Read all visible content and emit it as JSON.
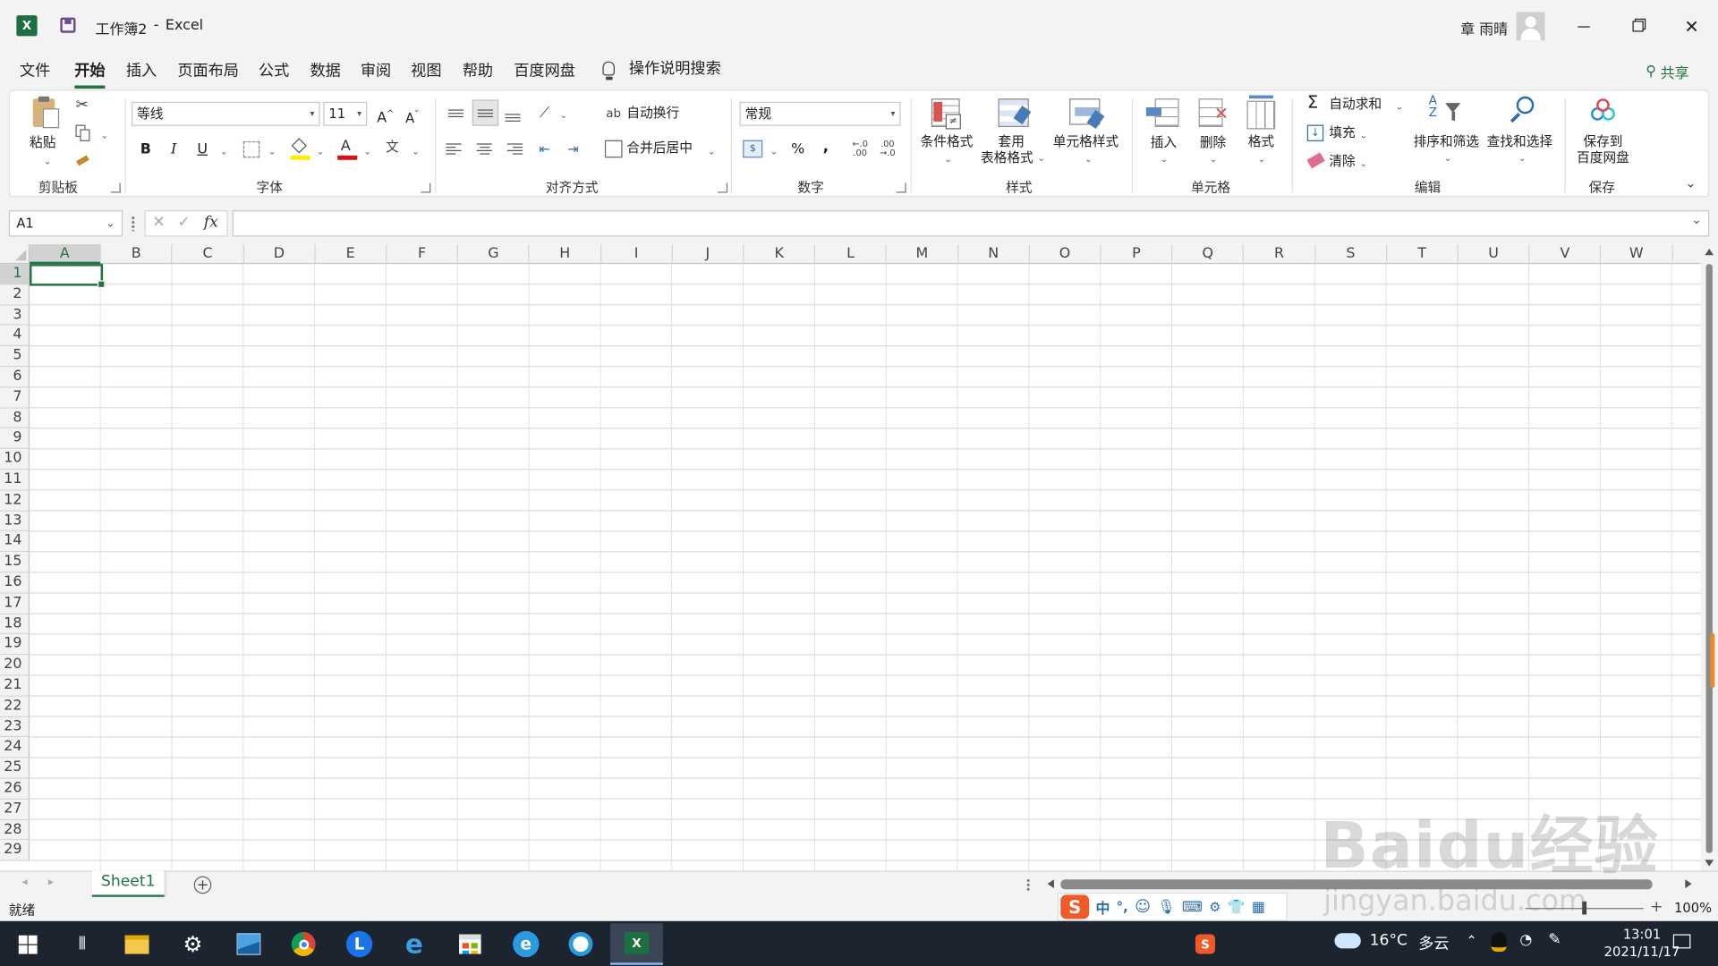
{
  "titlebar": {
    "doc_title": "工作簿2",
    "separator": "-",
    "app_name": "Excel",
    "user_name": "章 雨晴"
  },
  "menu": {
    "tabs": [
      {
        "label": "文件"
      },
      {
        "label": "开始"
      },
      {
        "label": "插入"
      },
      {
        "label": "页面布局"
      },
      {
        "label": "公式"
      },
      {
        "label": "数据"
      },
      {
        "label": "审阅"
      },
      {
        "label": "视图"
      },
      {
        "label": "帮助"
      },
      {
        "label": "百度网盘"
      }
    ],
    "active_tab": "开始",
    "search_label": "操作说明搜索",
    "share_label": "共享"
  },
  "ribbon": {
    "clipboard": {
      "paste": "粘贴",
      "group": "剪贴板"
    },
    "font": {
      "font_name": "等线",
      "font_size": "11",
      "bold": "B",
      "italic": "I",
      "underline": "U",
      "grow": "A",
      "shrink": "A",
      "font_color_glyph": "A",
      "phonetic_glyph": "文",
      "group": "字体"
    },
    "alignment": {
      "wrap": "自动换行",
      "merge": "合并后居中",
      "group": "对齐方式"
    },
    "number": {
      "format": "常规",
      "percent": "%",
      "comma": ",",
      "inc_decimal": "←.0\n.00",
      "group": "数字"
    },
    "styles": {
      "conditional": "条件格式",
      "table_line1": "套用",
      "table_line2": "表格格式",
      "cell_styles": "单元格样式",
      "group": "样式"
    },
    "cells": {
      "insert": "插入",
      "delete": "删除",
      "format": "格式",
      "group": "单元格"
    },
    "editing": {
      "autosum": "自动求和",
      "fill": "填充",
      "clear": "清除",
      "sort": "排序和筛选",
      "find": "查找和选择",
      "group": "编辑"
    },
    "save": {
      "line1": "保存到",
      "line2": "百度网盘",
      "group": "保存"
    }
  },
  "formula_bar": {
    "name_box": "A1",
    "fx": "fx",
    "value": ""
  },
  "grid": {
    "columns": [
      "A",
      "B",
      "C",
      "D",
      "E",
      "F",
      "G",
      "H",
      "I",
      "J",
      "K",
      "L",
      "M",
      "N",
      "O",
      "P",
      "Q",
      "R",
      "S",
      "T",
      "U",
      "V",
      "W"
    ],
    "rows": [
      "1",
      "2",
      "3",
      "4",
      "5",
      "6",
      "7",
      "8",
      "9",
      "10",
      "11",
      "12",
      "13",
      "14",
      "15",
      "16",
      "17",
      "18",
      "19",
      "20",
      "21",
      "22",
      "23",
      "24",
      "25",
      "26",
      "27",
      "28",
      "29"
    ],
    "selected_cell": "A1"
  },
  "sheets": {
    "tabs": [
      {
        "label": "Sheet1"
      }
    ],
    "active": "Sheet1"
  },
  "status": {
    "ready": "就绪",
    "zoom": "100%"
  },
  "taskbar": {
    "weather_temp": "16°C",
    "weather_text": "多云",
    "time": "13:01",
    "date": "2021/11/17",
    "ime_lang": "中"
  },
  "watermark": {
    "text1": "Baidu经验",
    "text2": "jingyan.baidu.com"
  },
  "colors": {
    "accent": "#217346",
    "taskbar": "#1c2430",
    "window_bg": "#f3f3f3"
  }
}
